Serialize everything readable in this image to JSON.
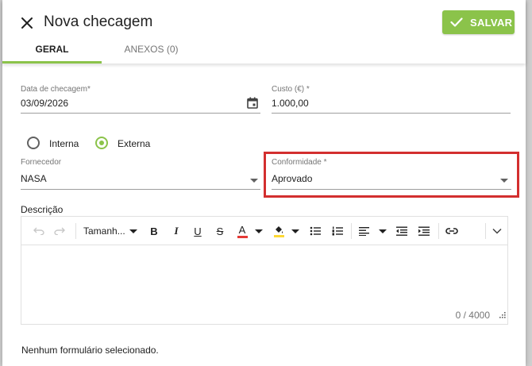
{
  "dialog": {
    "title": "Nova checagem",
    "save_label": "SALVAR"
  },
  "tabs": [
    {
      "label": "GERAL",
      "active": true
    },
    {
      "label": "ANEXOS (0)",
      "active": false
    }
  ],
  "form": {
    "date": {
      "label": "Data de checagem*",
      "value": "03/09/2026"
    },
    "cost": {
      "label": "Custo (€) *",
      "value": "1.000,00"
    },
    "type_options": [
      {
        "label": "Interna",
        "checked": false
      },
      {
        "label": "Externa",
        "checked": true
      }
    ],
    "supplier": {
      "label": "Fornecedor",
      "value": "NASA"
    },
    "conformity": {
      "label": "Conformidade *",
      "value": "Aprovado"
    },
    "description_label": "Descrição"
  },
  "editor": {
    "font_size_label": "Tamanh...",
    "counter": "0 / 4000"
  },
  "footer": {
    "no_form_text": "Nenhum formulário selecionado."
  },
  "colors": {
    "accent": "#8bc34a",
    "highlight": "#d32f2f",
    "text_color_indicator": "#e53935",
    "highlight_color_indicator": "#fdd835"
  }
}
